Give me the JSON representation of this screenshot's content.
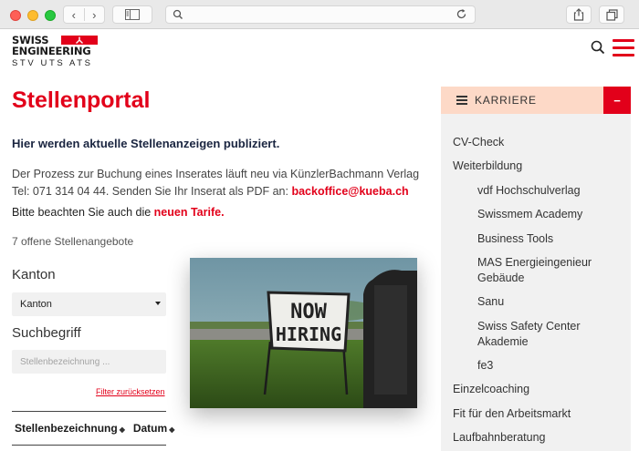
{
  "header": {
    "logo_line1": "SWISS",
    "logo_line2": "ENGINEERING",
    "logo_sub": "STV  UTS  ATS"
  },
  "main": {
    "title": "Stellenportal",
    "intro": "Hier werden aktuelle Stellenanzeigen publiziert.",
    "body_text": "Der Prozess zur Buchung eines Inserates läuft neu via KünzlerBachmann Verlag Tel: 071 314 04 44. Senden Sie Ihr Inserat als PDF an: ",
    "email": "backoffice@kueba.ch",
    "notice_text": "Bitte beachten Sie auch die ",
    "notice_link": "neuen Tarife.",
    "offer_count": "7 offene Stellenangebote",
    "photo_sign": [
      "NOW",
      "HIRING"
    ]
  },
  "filters": {
    "kanton_label": "Kanton",
    "kanton_value": "Kanton",
    "suchbegriff_label": "Suchbegriff",
    "search_placeholder": "Stellenbezeichnung ...",
    "reset_link": "Filter zurücksetzen"
  },
  "table": {
    "headers": [
      "Stellenbezeichnung",
      "Datum"
    ],
    "sort_symbol": "◆"
  },
  "sidebar": {
    "title": "KARRIERE",
    "toggle": "−",
    "items": [
      {
        "label": "CV-Check",
        "level": 1
      },
      {
        "label": "Weiterbildung",
        "level": 1
      },
      {
        "label": "vdf Hochschulverlag",
        "level": 2
      },
      {
        "label": "Swissmem Academy",
        "level": 2
      },
      {
        "label": "Business Tools",
        "level": 2
      },
      {
        "label": "MAS Energieingenieur Gebäude",
        "level": 2
      },
      {
        "label": "Sanu",
        "level": 2
      },
      {
        "label": "Swiss Safety Center Akademie",
        "level": 2
      },
      {
        "label": "fe3",
        "level": 2
      },
      {
        "label": "Einzelcoaching",
        "level": 1
      },
      {
        "label": "Fit für den Arbeitsmarkt",
        "level": 1
      },
      {
        "label": "Laufbahnberatung",
        "level": 1
      }
    ]
  },
  "colors": {
    "brand_red": "#e2001a",
    "sidebar_header": "#fdd9c7",
    "sidebar_bg": "#f1f1f1"
  }
}
